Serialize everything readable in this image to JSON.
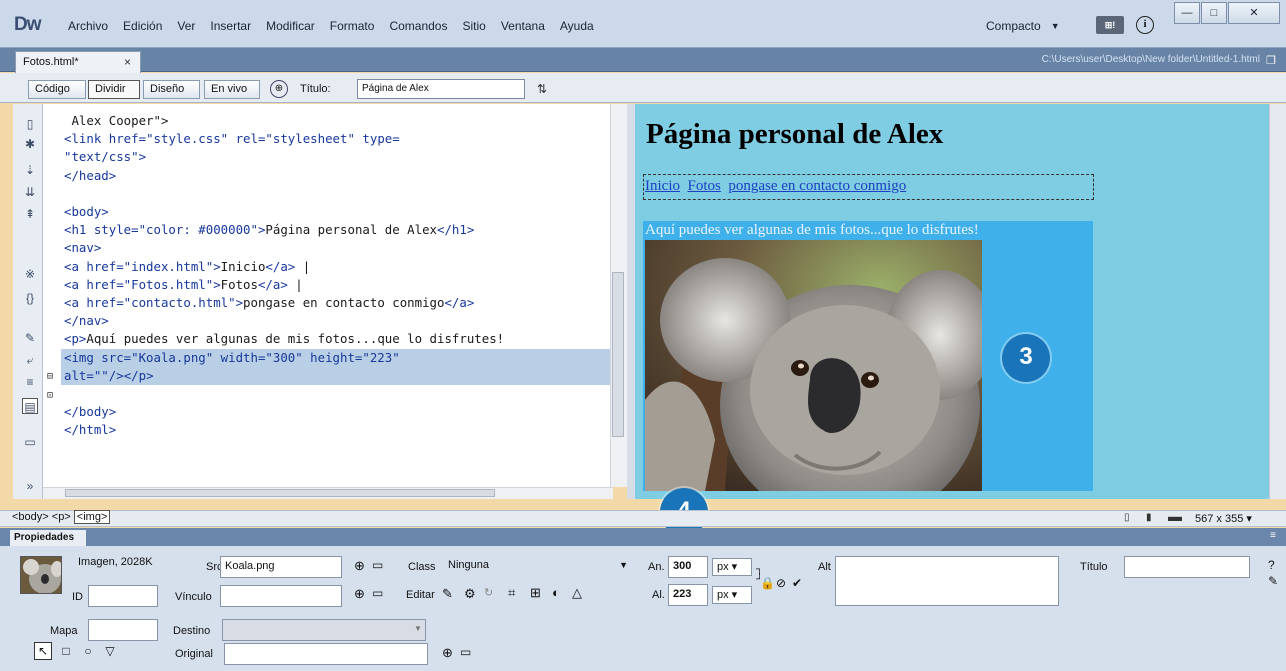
{
  "app": {
    "logo": "Dw",
    "menu": [
      "Archivo",
      "Edición",
      "Ver",
      "Insertar",
      "Modificar",
      "Formato",
      "Comandos",
      "Sitio",
      "Ventana",
      "Ayuda"
    ],
    "layout_mode": "Compacto",
    "sync_label": "⊞!",
    "window_buttons": {
      "minimize": "—",
      "maximize": "□",
      "close": "✕"
    }
  },
  "document": {
    "tab_label": "Fotos.html*",
    "tab_close": "×",
    "path": "C:\\Users\\user\\Desktop\\New folder\\Untitled-1.html"
  },
  "doc_toolbar": {
    "views": [
      "Código",
      "Dividir",
      "Diseño",
      "En vivo"
    ],
    "active_view": "Dividir",
    "title_label": "Título:",
    "title_value": "Página de Alex"
  },
  "code_lines": [
    {
      "segments": [
        {
          "t": " Alex Cooper\">",
          "c": "v"
        }
      ]
    },
    {
      "segments": [
        {
          "t": "<link ",
          "c": "t"
        },
        {
          "t": "href=\"style.css\" rel=\"stylesheet\" type=",
          "c": "a"
        }
      ]
    },
    {
      "segments": [
        {
          "t": "\"text/css\">",
          "c": "a"
        }
      ]
    },
    {
      "segments": [
        {
          "t": "</head>",
          "c": "t"
        }
      ]
    },
    {
      "segments": [
        {
          "t": "",
          "c": "v"
        }
      ]
    },
    {
      "segments": [
        {
          "t": "<body>",
          "c": "t"
        }
      ]
    },
    {
      "segments": [
        {
          "t": "<h1 style=\"color: #000000\">",
          "c": "t"
        },
        {
          "t": "Página personal de Alex",
          "c": "v"
        },
        {
          "t": "</h1>",
          "c": "t"
        }
      ]
    },
    {
      "segments": [
        {
          "t": "<nav>",
          "c": "t"
        }
      ]
    },
    {
      "segments": [
        {
          "t": "<a href=\"index.html\">",
          "c": "t"
        },
        {
          "t": "Inicio",
          "c": "v"
        },
        {
          "t": "</a>",
          "c": "t"
        },
        {
          "t": " |",
          "c": "v"
        }
      ]
    },
    {
      "segments": [
        {
          "t": "<a href=\"Fotos.html\">",
          "c": "t"
        },
        {
          "t": "Fotos",
          "c": "v"
        },
        {
          "t": "</a>",
          "c": "t"
        },
        {
          "t": " |",
          "c": "v"
        }
      ]
    },
    {
      "segments": [
        {
          "t": "<a href=\"contacto.html\">",
          "c": "t"
        },
        {
          "t": "pongase en contacto conmigo",
          "c": "v"
        },
        {
          "t": "</a>",
          "c": "t"
        }
      ]
    },
    {
      "segments": [
        {
          "t": "</nav>",
          "c": "t"
        }
      ]
    },
    {
      "segments": [
        {
          "t": "<p>",
          "c": "t"
        },
        {
          "t": "Aquí puedes ver algunas de mis fotos...que lo disfrutes!",
          "c": "v"
        }
      ]
    },
    {
      "segments": [
        {
          "t": "<img src=\"Koala.png\" width=\"300\" height=\"223\"",
          "c": "t"
        }
      ],
      "selected": true
    },
    {
      "segments": [
        {
          "t": "alt=\"\"/>",
          "c": "t"
        },
        {
          "t": "</p>",
          "c": "t"
        }
      ],
      "selected": true
    },
    {
      "segments": [
        {
          "t": "",
          "c": "v"
        }
      ]
    },
    {
      "segments": [
        {
          "t": "</body>",
          "c": "t"
        }
      ]
    },
    {
      "segments": [
        {
          "t": "</html>",
          "c": "t"
        }
      ]
    }
  ],
  "design": {
    "heading": "Página personal de Alex",
    "nav_links": [
      "Inicio",
      "Fotos",
      "pongase en contacto conmigo"
    ],
    "paragraph": "Aquí puedes ver algunas de mis fotos...que lo disfrutes!"
  },
  "callouts": {
    "c3": "3",
    "c4": "4"
  },
  "status": {
    "tag_selector": [
      "<body>",
      "<p>",
      "<img>"
    ],
    "window_size": "567 x 355 ▾"
  },
  "properties": {
    "panel_title": "Propiedades",
    "element_type": "Imagen, 2028K",
    "id_label": "ID",
    "id_value": "",
    "src_label": "Src",
    "src_value": "Koala.png",
    "class_label": "Class",
    "class_value": "Ninguna",
    "width_label": "An.",
    "width_value": "300",
    "height_label": "Al.",
    "height_value": "223",
    "unit": "px",
    "alt_label": "Alt",
    "alt_value": "",
    "title_label": "Título",
    "title_value": "",
    "link_label": "Vínculo",
    "link_value": "",
    "edit_label": "Editar",
    "map_label": "Mapa",
    "map_value": "",
    "target_label": "Destino",
    "target_value": "",
    "original_label": "Original",
    "original_value": ""
  },
  "colors": {
    "design_bg": "#7fcde3",
    "paragraph_bg": "#3fb0ea",
    "callout": "#1a74b9",
    "selection": "#b9cfe6"
  }
}
